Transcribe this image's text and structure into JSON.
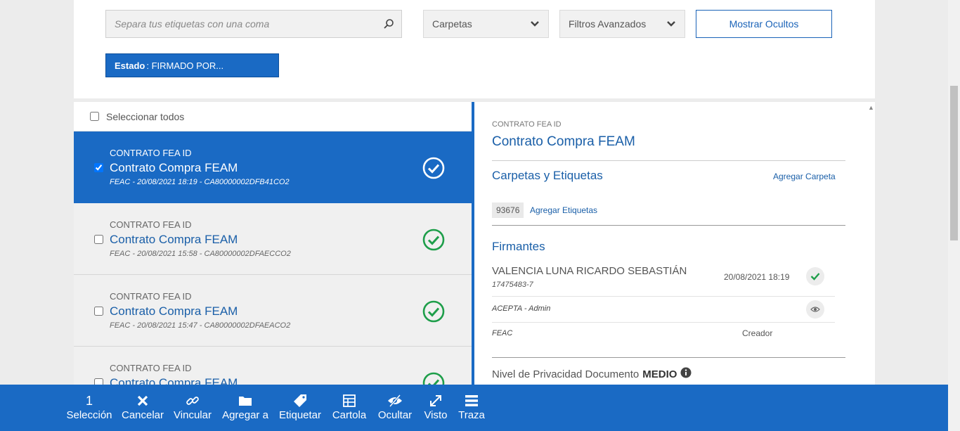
{
  "filters": {
    "search_placeholder": "Separa tus etiquetas con una coma",
    "folders_label": "Carpetas",
    "advanced_label": "Filtros Avanzados",
    "show_hidden_label": "Mostrar Ocultos",
    "chip_key": "Estado",
    "chip_value": ": FIRMADO POR..."
  },
  "list": {
    "select_all_label": "Seleccionar todos",
    "items": [
      {
        "kind": "CONTRATO FEA ID",
        "title": "Contrato Compra FEAM",
        "meta": "FEAC - 20/08/2021 18:19 - CA80000002DFB41CO2",
        "selected": true
      },
      {
        "kind": "CONTRATO FEA ID",
        "title": "Contrato Compra FEAM",
        "meta": "FEAC - 20/08/2021 15:58 - CA80000002DFAECCO2",
        "selected": false
      },
      {
        "kind": "CONTRATO FEA ID",
        "title": "Contrato Compra FEAM",
        "meta": "FEAC - 20/08/2021 15:47 - CA80000002DFAEACO2",
        "selected": false
      },
      {
        "kind": "CONTRATO FEA ID",
        "title": "Contrato Compra FEAM",
        "meta": "",
        "selected": false
      }
    ]
  },
  "detail": {
    "kind": "CONTRATO FEA ID",
    "title": "Contrato Compra FEAM",
    "folders_heading": "Carpetas y Etiquetas",
    "add_folder": "Agregar Carpeta",
    "tag": "93676",
    "add_tags": "Agregar Etiquetas",
    "signers_heading": "Firmantes",
    "signer_name": "VALENCIA LUNA RICARDO SEBASTIÁN",
    "signer_id": "17475483-7",
    "signer_date": "20/08/2021 18:19",
    "accept_text": "ACEPTA - Admin",
    "creator_org": "FEAC",
    "creator_label": "Creador",
    "privacy_label": "Nivel de Privacidad Documento",
    "privacy_value": "MEDIO"
  },
  "toolbar": {
    "selection_count": "1",
    "selection_label": "Selección",
    "cancel": "Cancelar",
    "link": "Vincular",
    "add_to": "Agregar a",
    "tag": "Etiquetar",
    "cartola": "Cartola",
    "hide": "Ocultar",
    "seen": "Visto",
    "trace": "Traza"
  },
  "colors": {
    "primary": "#1a6ac4",
    "success": "#1e9e4a"
  }
}
